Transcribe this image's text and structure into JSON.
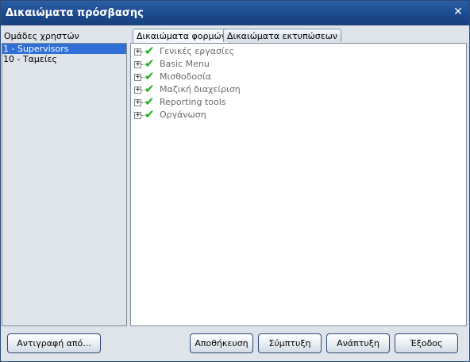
{
  "window": {
    "title": "Δικαιώματα πρόσβασης"
  },
  "groups": {
    "label": "Ομάδες χρηστών",
    "items": [
      {
        "label": "1 - Supervisors",
        "selected": true
      },
      {
        "label": "10 - Ταμείες",
        "selected": false
      }
    ]
  },
  "tabs": [
    {
      "label": "Δικαιώματα φορμών",
      "active": true
    },
    {
      "label": "Δικαιώματα εκτυπώσεων",
      "active": false
    }
  ],
  "tree": [
    {
      "label": "Γενικές εργασίες",
      "checked": true,
      "expander": "+"
    },
    {
      "label": "Basic Menu",
      "checked": true,
      "expander": "+"
    },
    {
      "label": "Μισθοδοσία",
      "checked": true,
      "expander": "+"
    },
    {
      "label": "Μαζική διαχείριση",
      "checked": true,
      "expander": "+"
    },
    {
      "label": "Reporting tools",
      "checked": true,
      "expander": "+"
    },
    {
      "label": "Οργάνωση",
      "checked": true,
      "expander": "+"
    }
  ],
  "buttons": {
    "copy_from": "Αντιγραφή από...",
    "save": "Αποθήκευση",
    "collapse": "Σύμπτυξη",
    "expand": "Ανάπτυξη",
    "exit": "Έξοδος"
  },
  "colors": {
    "titlebar": "#1e4d94",
    "selection": "#2f6fd6",
    "check": "#22b022"
  }
}
